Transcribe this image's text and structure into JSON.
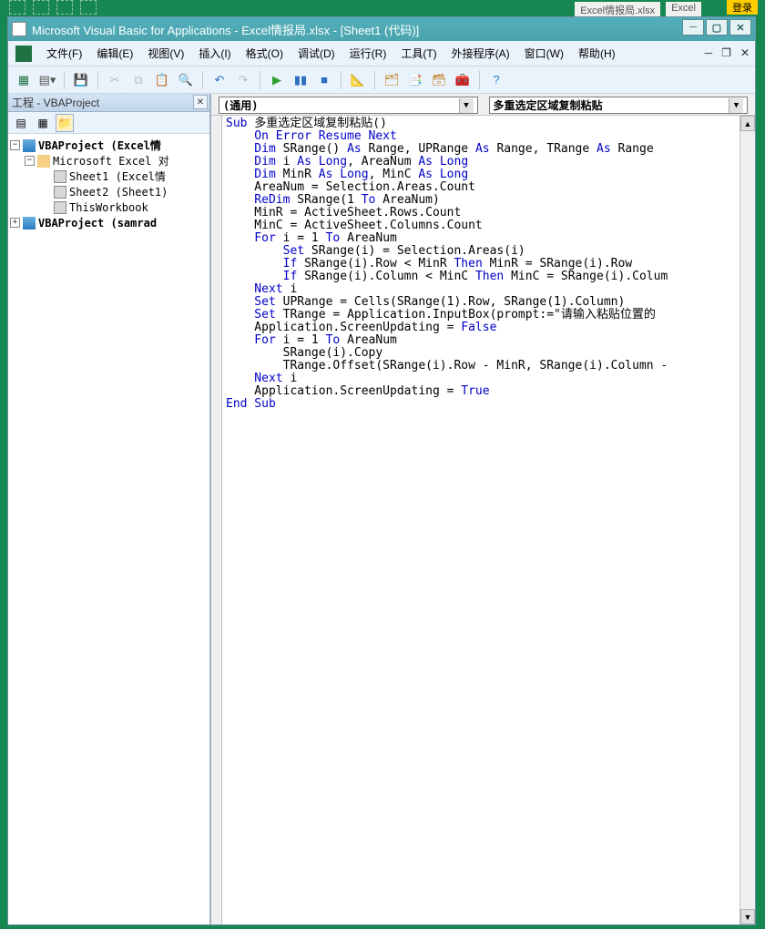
{
  "excel_top": {
    "tab1": "Excel情报局.xlsx",
    "tab2": "Excel",
    "login": "登录"
  },
  "titlebar": "Microsoft Visual Basic for Applications - Excel情报局.xlsx - [Sheet1 (代码)]",
  "menus": {
    "file": "文件(F)",
    "edit": "编辑(E)",
    "view": "视图(V)",
    "insert": "插入(I)",
    "format": "格式(O)",
    "debug": "调试(D)",
    "run": "运行(R)",
    "tools": "工具(T)",
    "addins": "外接程序(A)",
    "window": "窗口(W)",
    "help": "帮助(H)"
  },
  "project": {
    "title": "工程 - VBAProject",
    "root1": "VBAProject (Excel情",
    "excel_objects": "Microsoft Excel 对",
    "sheet1": "Sheet1 (Excel情",
    "sheet2": "Sheet2 (Sheet1)",
    "thiswb": "ThisWorkbook",
    "root2": "VBAProject (samrad"
  },
  "combos": {
    "object": "(通用)",
    "proc": "多重选定区域复制粘贴"
  },
  "code": {
    "l01a": "Sub",
    "l01b": " 多重选定区域复制粘贴()",
    "l02a": "    On Error Resume Next",
    "l03a": "    Dim",
    "l03b": " SRange() ",
    "l03c": "As",
    "l03d": " Range, UPRange ",
    "l03e": "As",
    "l03f": " Range, TRange ",
    "l03g": "As",
    "l03h": " Range",
    "l04a": "    Dim",
    "l04b": " i ",
    "l04c": "As Long",
    "l04d": ", AreaNum ",
    "l04e": "As Long",
    "l05a": "    Dim",
    "l05b": " MinR ",
    "l05c": "As Long",
    "l05d": ", MinC ",
    "l05e": "As Long",
    "l06": "    AreaNum = Selection.Areas.Count",
    "l07a": "    ReDim",
    "l07b": " SRange(1 ",
    "l07c": "To",
    "l07d": " AreaNum)",
    "l08": "    MinR = ActiveSheet.Rows.Count",
    "l09": "    MinC = ActiveSheet.Columns.Count",
    "l10a": "    For",
    "l10b": " i = 1 ",
    "l10c": "To",
    "l10d": " AreaNum",
    "l11a": "        Set",
    "l11b": " SRange(i) = Selection.Areas(i)",
    "l12a": "        If",
    "l12b": " SRange(i).Row < MinR ",
    "l12c": "Then",
    "l12d": " MinR = SRange(i).Row",
    "l13a": "        If",
    "l13b": " SRange(i).Column < MinC ",
    "l13c": "Then",
    "l13d": " MinC = SRange(i).Colum",
    "l14a": "    Next",
    "l14b": " i",
    "l15a": "    Set",
    "l15b": " UPRange = Cells(SRange(1).Row, SRange(1).Column)",
    "l16a": "    Set",
    "l16b": " TRange = Application.InputBox(prompt:=\"请输入粘贴位置的",
    "l17a": "    Application.ScreenUpdating = ",
    "l17b": "False",
    "l18a": "    For",
    "l18b": " i = 1 ",
    "l18c": "To",
    "l18d": " AreaNum",
    "l19": "        SRange(i).Copy",
    "l20": "        TRange.Offset(SRange(i).Row - MinR, SRange(i).Column -",
    "l21a": "    Next",
    "l21b": " i",
    "l22a": "    Application.ScreenUpdating = ",
    "l22b": "True",
    "l23": "End Sub"
  }
}
